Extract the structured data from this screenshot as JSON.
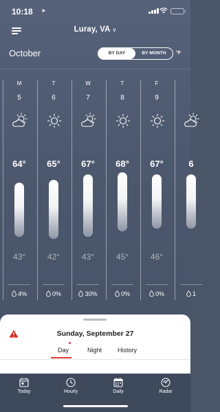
{
  "status_bar": {
    "time": "10:18"
  },
  "header": {
    "location": "Luray, VA"
  },
  "calendar": {
    "month": "October",
    "toggle": {
      "by_day": "BY DAY",
      "by_month": "BY MONTH",
      "active": "by_day"
    },
    "unit": "°F"
  },
  "days": [
    {
      "dow": "M",
      "date": "5",
      "icon": "partly-cloudy-icon",
      "high": "64°",
      "low": "43°",
      "high_value": 64,
      "low_value": 43,
      "precip": "4%"
    },
    {
      "dow": "T",
      "date": "6",
      "icon": "sunny-icon",
      "high": "65°",
      "low": "42°",
      "high_value": 65,
      "low_value": 42,
      "precip": "0%"
    },
    {
      "dow": "W",
      "date": "7",
      "icon": "partly-cloudy-icon",
      "high": "67°",
      "low": "43°",
      "high_value": 67,
      "low_value": 43,
      "precip": "30%"
    },
    {
      "dow": "T",
      "date": "8",
      "icon": "sunny-icon",
      "high": "68°",
      "low": "45°",
      "high_value": 68,
      "low_value": 45,
      "precip": "0%"
    },
    {
      "dow": "F",
      "date": "9",
      "icon": "sunny-icon",
      "high": "67°",
      "low": "46°",
      "high_value": 67,
      "low_value": 46,
      "precip": "0%"
    },
    {
      "dow": "",
      "date": "",
      "icon": "partly-cloudy-icon",
      "high": "6",
      "low": "",
      "high_value": 67,
      "low_value": 46,
      "precip": "1"
    }
  ],
  "detail_sheet": {
    "date": "Sunday, September 27",
    "tabs": [
      "Day",
      "Night",
      "History"
    ],
    "active_tab": "Day"
  },
  "bottom_nav": {
    "items": [
      {
        "label": "Today",
        "icon": "calendar-today-icon"
      },
      {
        "label": "Hourly",
        "icon": "clock-icon"
      },
      {
        "label": "Daily",
        "icon": "calendar-grid-icon"
      },
      {
        "label": "Radar",
        "icon": "radar-icon"
      }
    ],
    "active": "Daily"
  },
  "colors": {
    "background": "#4c586d",
    "accent": "#e8352f",
    "nav_background": "#3e4a5c"
  }
}
